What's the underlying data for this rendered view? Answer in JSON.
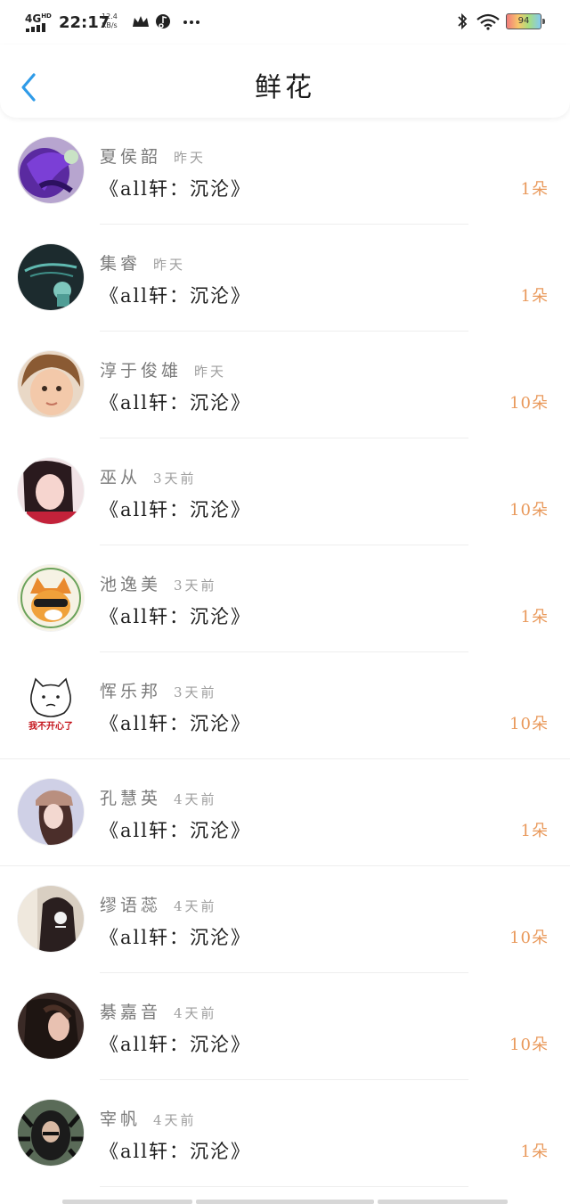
{
  "status_bar": {
    "network": "4G",
    "network_sup": "HD",
    "time": "22:17",
    "speed_value": "12.4",
    "speed_unit": "KB/s",
    "battery": "94",
    "icons": [
      "crown-icon",
      "music-icon",
      "more-dots-icon",
      "bluetooth-icon",
      "wifi-icon",
      "battery-icon"
    ]
  },
  "header": {
    "title": "鲜花",
    "back_icon": "chevron-left-icon",
    "accent_color": "#2f9be8"
  },
  "colors": {
    "name": "#7a7a7a",
    "time": "#9e9e9e",
    "book": "#1e1e1e",
    "count": "#e9995b"
  },
  "items": [
    {
      "name": "夏侯韶",
      "time": "昨天",
      "book": "《all轩：沉沦》",
      "count": "1朵"
    },
    {
      "name": "集睿",
      "time": "昨天",
      "book": "《all轩：沉沦》",
      "count": "1朵"
    },
    {
      "name": "淳于俊雄",
      "time": "昨天",
      "book": "《all轩：沉沦》",
      "count": "10朵"
    },
    {
      "name": "巫从",
      "time": "3天前",
      "book": "《all轩：沉沦》",
      "count": "10朵"
    },
    {
      "name": "池逸美",
      "time": "3天前",
      "book": "《all轩：沉沦》",
      "count": "1朵"
    },
    {
      "name": "恽乐邦",
      "time": "3天前",
      "book": "《all轩：沉沦》",
      "count": "10朵",
      "avatar_caption": "我不开心了"
    },
    {
      "name": "孔慧英",
      "time": "4天前",
      "book": "《all轩：沉沦》",
      "count": "1朵"
    },
    {
      "name": "缪语蕊",
      "time": "4天前",
      "book": "《all轩：沉沦》",
      "count": "10朵"
    },
    {
      "name": "綦嘉音",
      "time": "4天前",
      "book": "《all轩：沉沦》",
      "count": "10朵"
    },
    {
      "name": "宰帆",
      "time": "4天前",
      "book": "《all轩：沉沦》",
      "count": "1朵"
    }
  ]
}
